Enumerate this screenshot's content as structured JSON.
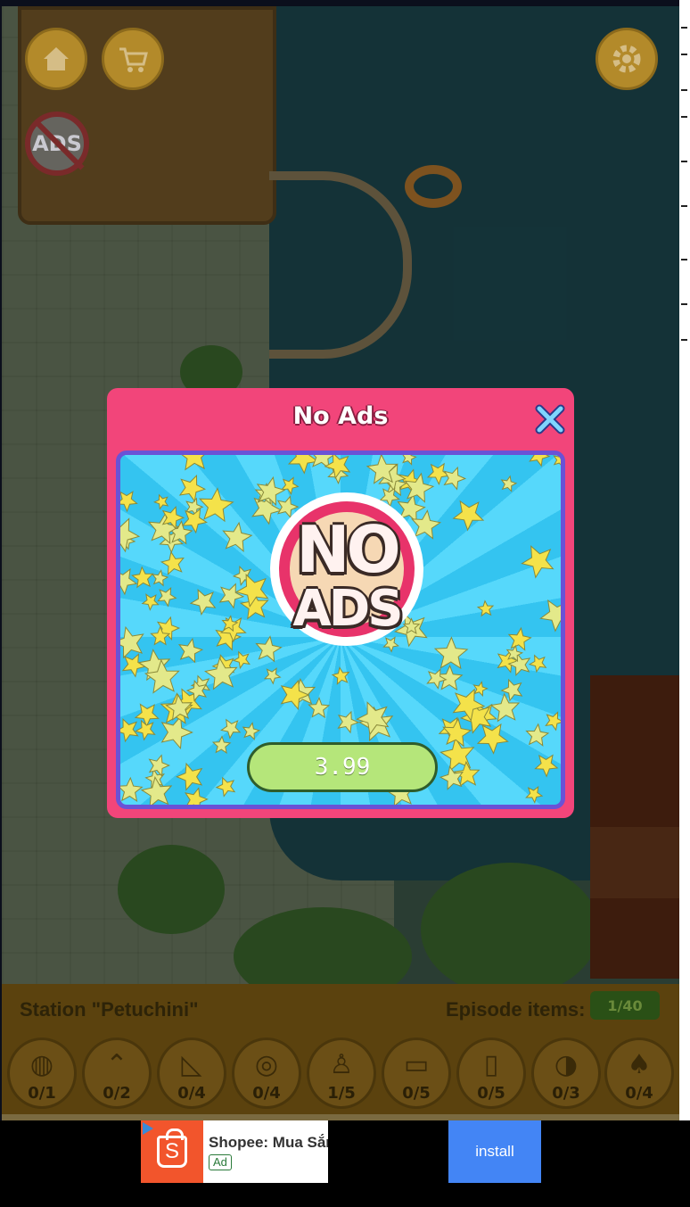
{
  "game": {
    "station_title": "Station \"Petuchini\"",
    "episode_label": "Episode items:",
    "episode_count": "1/40",
    "items": [
      {
        "icon": "basketball-icon",
        "glyph": "◍",
        "count": "0/1"
      },
      {
        "icon": "boomerang-icon",
        "glyph": "⌃",
        "count": "0/2"
      },
      {
        "icon": "pizza-slice-icon",
        "glyph": "◺",
        "count": "0/4"
      },
      {
        "icon": "donut-icon",
        "glyph": "◎",
        "count": "0/4"
      },
      {
        "icon": "kettlebell-icon",
        "glyph": "♙",
        "count": "1/5"
      },
      {
        "icon": "shorts-icon",
        "glyph": "▭",
        "count": "0/5"
      },
      {
        "icon": "toilet-paper-icon",
        "glyph": "▯",
        "count": "0/5"
      },
      {
        "icon": "flip-flop-icon",
        "glyph": "◑",
        "count": "0/3"
      },
      {
        "icon": "mushroom-icon",
        "glyph": "♠",
        "count": "0/4"
      }
    ],
    "top_buttons": {
      "home_icon": "home-icon",
      "shop_icon": "shopping-cart-icon",
      "settings_icon": "gear-icon",
      "no_ads_badge": "ADS"
    }
  },
  "modal": {
    "title": "No Ads",
    "close_icon": "close-icon",
    "emblem_line1": "NO",
    "emblem_line2": "ADS",
    "price": "3.99"
  },
  "ad": {
    "app_name": "Shopee: Mua Sắm",
    "ad_label": "Ad",
    "install_label": "install",
    "logo_letter": "S"
  },
  "colors": {
    "modal_pink": "#f2457a",
    "panel_blue": "#34c4f0",
    "buy_green": "#b5e67a",
    "install_blue": "#4385f5",
    "shopee_orange": "#f2552c"
  }
}
